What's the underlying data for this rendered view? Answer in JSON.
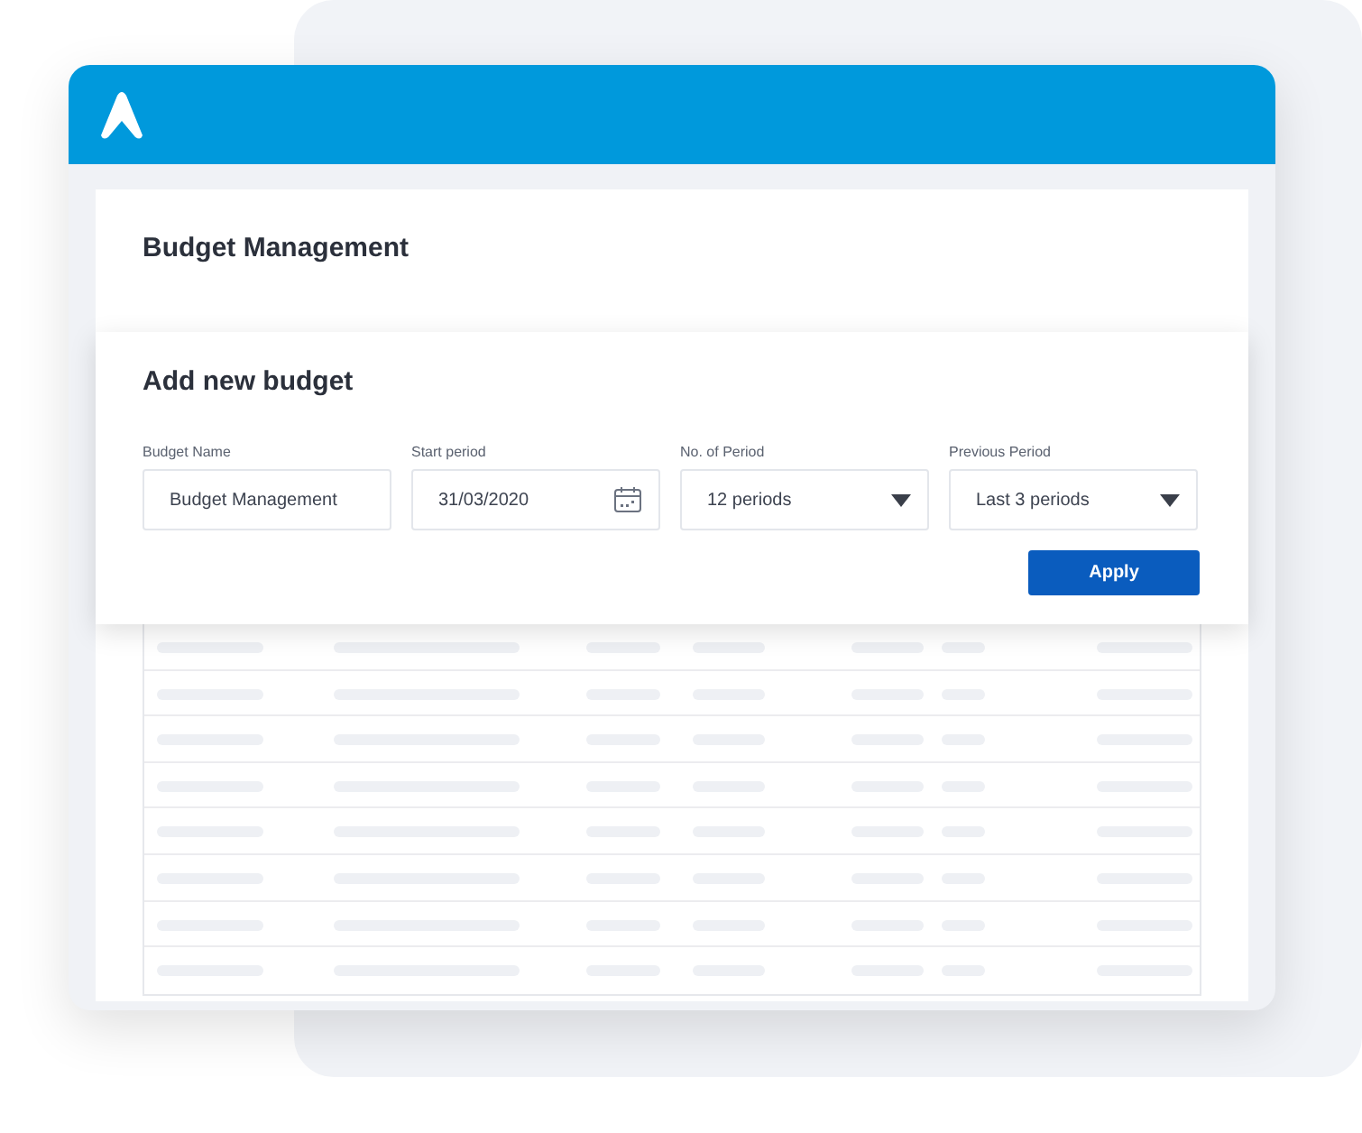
{
  "page": {
    "title": "Budget Management"
  },
  "dialog": {
    "title": "Add new budget",
    "fields": [
      {
        "kind": "text",
        "label": "Budget Name",
        "value": "Budget Management"
      },
      {
        "kind": "date",
        "label": "Start period",
        "value": "31/03/2020"
      },
      {
        "kind": "select",
        "label": "No. of Period",
        "value": "12 periods"
      },
      {
        "kind": "select",
        "label": "Previous Period",
        "value": "Last 3 periods"
      }
    ],
    "buttons": [
      "Apply"
    ]
  }
}
